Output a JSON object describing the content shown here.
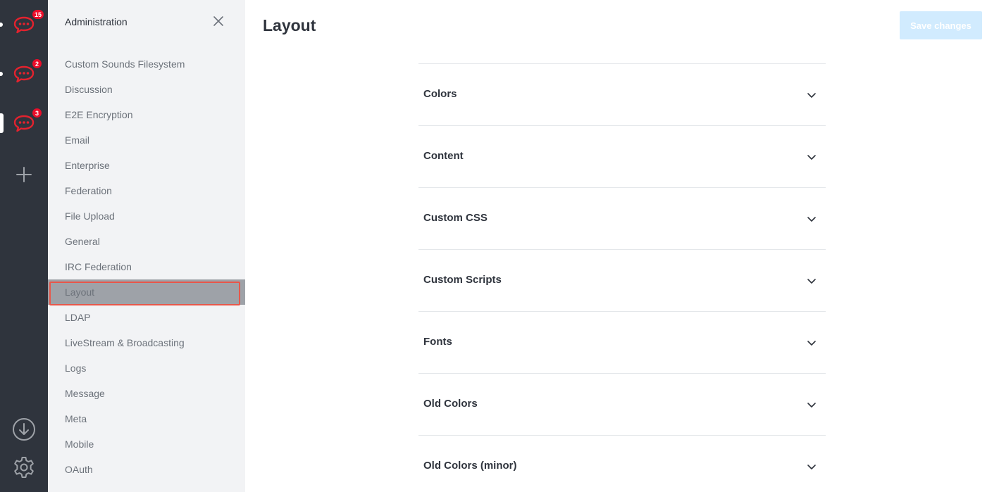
{
  "rail": {
    "servers": [
      {
        "name": "server-1",
        "badge": "15",
        "active": false
      },
      {
        "name": "server-2",
        "badge": "2",
        "active": false
      },
      {
        "name": "server-3",
        "badge": "3",
        "active": true
      }
    ],
    "icons": {
      "add": "plus-icon",
      "download": "download-icon",
      "settings": "gear-icon"
    },
    "colors": {
      "rail_bg": "#2f343d",
      "logo": "#e3222e",
      "badge": "#ec0d2a"
    }
  },
  "sidebar": {
    "title": "Administration",
    "items": [
      {
        "label": "Custom Sounds Filesystem"
      },
      {
        "label": "Discussion"
      },
      {
        "label": "E2E Encryption"
      },
      {
        "label": "Email"
      },
      {
        "label": "Enterprise"
      },
      {
        "label": "Federation"
      },
      {
        "label": "File Upload"
      },
      {
        "label": "General"
      },
      {
        "label": "IRC Federation"
      },
      {
        "label": "Layout",
        "active": true
      },
      {
        "label": "LDAP"
      },
      {
        "label": "LiveStream & Broadcasting"
      },
      {
        "label": "Logs"
      },
      {
        "label": "Message"
      },
      {
        "label": "Meta"
      },
      {
        "label": "Mobile"
      },
      {
        "label": "OAuth"
      }
    ]
  },
  "main": {
    "title": "Layout",
    "save_label": "Save changes",
    "sections": [
      {
        "label": "Colors"
      },
      {
        "label": "Content"
      },
      {
        "label": "Custom CSS"
      },
      {
        "label": "Custom Scripts"
      },
      {
        "label": "Fonts"
      },
      {
        "label": "Old Colors"
      },
      {
        "label": "Old Colors (minor)"
      }
    ]
  }
}
